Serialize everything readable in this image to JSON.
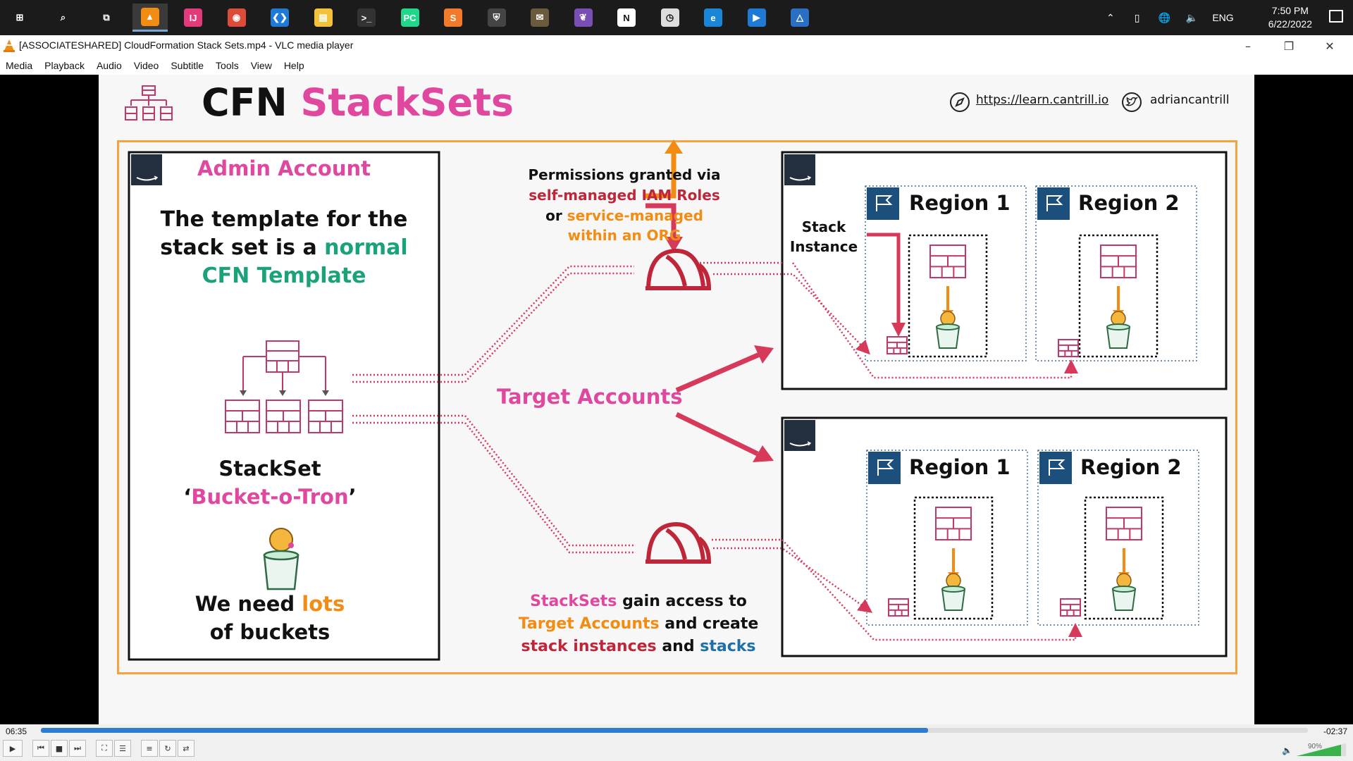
{
  "taskbar": {
    "apps": [
      {
        "name": "start",
        "glyph": "⊞"
      },
      {
        "name": "search",
        "glyph": "⌕"
      },
      {
        "name": "task-view",
        "glyph": "⧉"
      },
      {
        "name": "vlc",
        "glyph": "▲"
      },
      {
        "name": "intellij",
        "glyph": "IJ"
      },
      {
        "name": "chrome",
        "glyph": "◉"
      },
      {
        "name": "vscode",
        "glyph": "❮❯"
      },
      {
        "name": "file-explorer",
        "glyph": "▤"
      },
      {
        "name": "terminal",
        "glyph": ">_"
      },
      {
        "name": "pycharm",
        "glyph": "PC"
      },
      {
        "name": "sublime",
        "glyph": "S"
      },
      {
        "name": "security",
        "glyph": "⛨"
      },
      {
        "name": "app-13",
        "glyph": "✉"
      },
      {
        "name": "app-14",
        "glyph": "❦"
      },
      {
        "name": "notion",
        "glyph": "N"
      },
      {
        "name": "clock-app",
        "glyph": "◷"
      },
      {
        "name": "edge",
        "glyph": "e"
      },
      {
        "name": "media-player",
        "glyph": "▶"
      },
      {
        "name": "photos",
        "glyph": "△"
      }
    ],
    "tray": {
      "language": "ENG",
      "time": "7:50 PM",
      "date": "6/22/2022"
    }
  },
  "window": {
    "title": "[ASSOCIATESHARED] CloudFormation Stack Sets.mp4 - VLC media player",
    "menu": [
      "Media",
      "Playback",
      "Audio",
      "Video",
      "Subtitle",
      "Tools",
      "View",
      "Help"
    ]
  },
  "slide": {
    "title_black": "CFN",
    "title_pink": "StackSets",
    "link": "https://learn.cantrill.io",
    "twitter": "adriancantrill",
    "aws_logo": "aws",
    "admin": {
      "heading": "Admin Account",
      "line1": "The template for the",
      "line2_a": "stack set is a",
      "line2_b": "normal",
      "line3": "CFN Template",
      "stackset_label": "StackSet",
      "stackset_name_open": "‘",
      "stackset_name": "Bucket-o-Tron",
      "stackset_name_close": "’",
      "need_a": "We need",
      "need_b": "lots",
      "need_c": "of buckets"
    },
    "permissions": {
      "line1": "Permissions granted via",
      "line2": "self-managed IAM Roles",
      "line3_a": "or",
      "line3_b": "service-managed",
      "line4": "within an ORG"
    },
    "target_accounts": "Target Accounts",
    "stack_instance": [
      "Stack",
      "Instance"
    ],
    "regions": {
      "r1": "Region 1",
      "r2": "Region 2"
    },
    "bottom": {
      "l1_a": "StackSets",
      "l1_b": "gain access to",
      "l2_a": "Target Accounts",
      "l2_b": "and create",
      "l3_a": "stack instances",
      "l3_b": "and",
      "l3_c": "stacks"
    },
    "colors": {
      "pink": "#e0479e",
      "green": "#1aa37a",
      "orange": "#f28c13",
      "red": "#c0263a",
      "crimson": "#d6395a",
      "blue": "#1f6fa8",
      "frame_orange": "#f4a340",
      "region_blue": "#1d4f7c"
    }
  },
  "player": {
    "elapsed": "06:35",
    "remaining": "-02:37",
    "progress": 0.7,
    "volume": "90%",
    "volume_level": 0.9
  }
}
